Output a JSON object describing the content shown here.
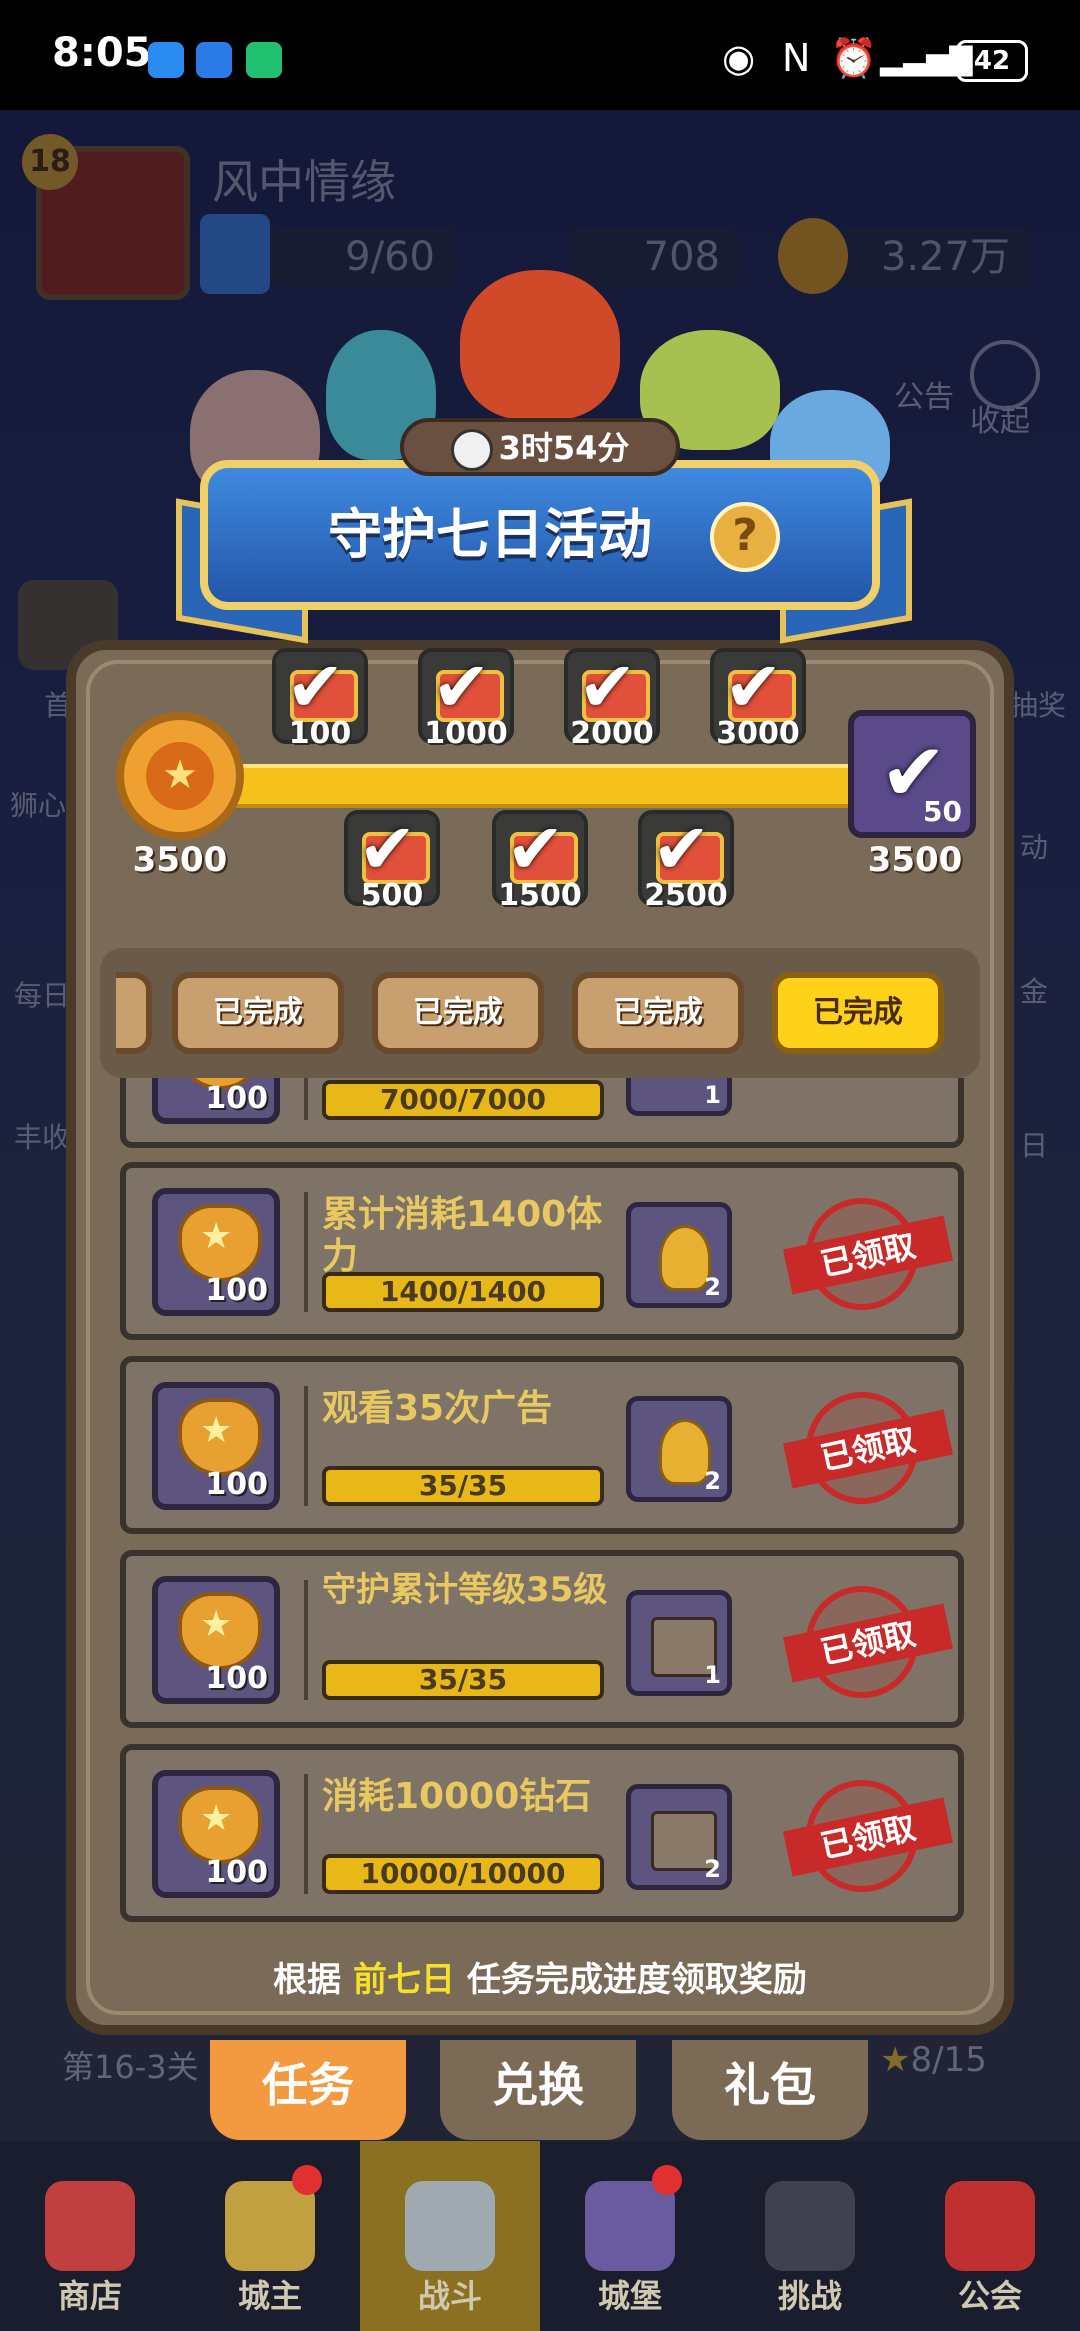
{
  "status_bar": {
    "time": "8:05",
    "battery": "42"
  },
  "player": {
    "level": "18",
    "name": "风中情缘",
    "stamina": "9/60",
    "gems": "708",
    "gold": "3.27万"
  },
  "top_right": {
    "announce": "公告",
    "collapse": "收起"
  },
  "side_left": [
    "首",
    "狮心",
    "每日",
    "丰收"
  ],
  "side_right": [
    "抽奖",
    "动",
    "金",
    "日"
  ],
  "stage": "第16-3关",
  "stars": "8/15",
  "event": {
    "timer": "3时54分",
    "title": "守护七日活动",
    "help": "?",
    "start_value": "3500",
    "final_value": "3500",
    "final_count": "50",
    "milestones_top": [
      "100",
      "1000",
      "2000",
      "3000"
    ],
    "milestones_bottom": [
      "500",
      "1500",
      "2500"
    ],
    "day_tabs": [
      "已完成",
      "已完成",
      "已完成",
      "已完成"
    ],
    "tasks": [
      {
        "title": "",
        "progress": "7000/7000",
        "points": "100",
        "reward_count": "1",
        "status": ""
      },
      {
        "title": "累计消耗1400体力",
        "progress": "1400/1400",
        "points": "100",
        "reward_count": "2",
        "status": "已领取"
      },
      {
        "title": "观看35次广告",
        "progress": "35/35",
        "points": "100",
        "reward_count": "2",
        "status": "已领取"
      },
      {
        "title": "守护累计等级35级",
        "progress": "35/35",
        "points": "100",
        "reward_count": "1",
        "status": "已领取"
      },
      {
        "title": "消耗10000钻石",
        "progress": "10000/10000",
        "points": "100",
        "reward_count": "2",
        "status": "已领取"
      }
    ],
    "footer": {
      "pre": "根据 ",
      "highlight": "前七日",
      "post": " 任务完成进度领取奖励"
    }
  },
  "sub_tabs": [
    "任务",
    "兑换",
    "礼包"
  ],
  "bottom_nav": [
    "商店",
    "城主",
    "战斗",
    "城堡",
    "挑战",
    "公会"
  ],
  "colors": {
    "progress": "#f5c21b",
    "active_tab": "#ffd21a",
    "stamp": "#c82a2a",
    "banner": "#2f6cc8"
  }
}
